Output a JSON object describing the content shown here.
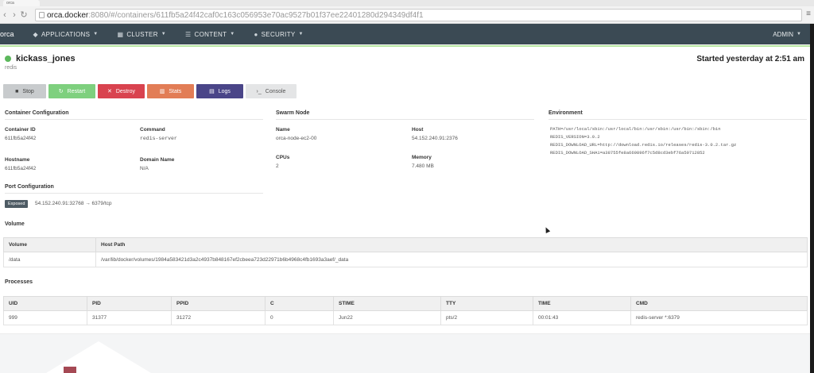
{
  "browser": {
    "tab_title": "orca",
    "url_host": "orca.docker",
    "url_rest": ":8080/#/containers/611fb5a24f42caf0c163c056953e70ac9527b01f37ee22401280d294349df4f1"
  },
  "nav": {
    "brand": "orca",
    "items": [
      {
        "label": "APPLICATIONS",
        "icon": "rocket-icon"
      },
      {
        "label": "CLUSTER",
        "icon": "server-icon"
      },
      {
        "label": "CONTENT",
        "icon": "list-icon"
      },
      {
        "label": "SECURITY",
        "icon": "lock-icon"
      }
    ],
    "admin": "ADMIN"
  },
  "container": {
    "name": "kickass_jones",
    "image": "redis",
    "started": "Started yesterday at 2:51 am",
    "status_color": "#5cb85c"
  },
  "actions": {
    "stop": "Stop",
    "restart": "Restart",
    "destroy": "Destroy",
    "stats": "Stats",
    "logs": "Logs",
    "console": "Console"
  },
  "container_config": {
    "title": "Container Configuration",
    "container_id_label": "Container ID",
    "container_id": "611fb5a24f42",
    "command_label": "Command",
    "command": "redis-server",
    "hostname_label": "Hostname",
    "hostname": "611fb5a24f42",
    "domain_label": "Domain Name",
    "domain": "N/A"
  },
  "swarm_node": {
    "title": "Swarm Node",
    "name_label": "Name",
    "name": "orca-node-ec2-00",
    "host_label": "Host",
    "host": "54.152.240.91:2376",
    "cpus_label": "CPUs",
    "cpus": "2",
    "memory_label": "Memory",
    "memory": "7.480 MB"
  },
  "environment": {
    "title": "Environment",
    "lines": [
      "PATH=/usr/local/sbin:/usr/local/bin:/usr/sbin:/usr/bin:/sbin:/bin",
      "REDIS_VERSION=3.0.2",
      "REDIS_DOWNLOAD_URL=http://download.redis.io/releases/redis-3.0.2.tar.gz",
      "REDIS_DOWNLOAD_SHA1=a38755fe8a669896f7c5d8cd3ebf76a59712852"
    ]
  },
  "port_config": {
    "title": "Port Configuration",
    "badge": "Exposed",
    "mapping": "54.152.240.91:32768 → 6379/tcp"
  },
  "volume": {
    "title": "Volume",
    "headers": [
      "Volume",
      "Host Path"
    ],
    "rows": [
      [
        "/data",
        "/var/lib/docker/volumes/1984a583421d3a2c4937b848167ef2cbeea723d22971b6b4968c4fb1693a3aef/_data"
      ]
    ]
  },
  "processes": {
    "title": "Processes",
    "headers": [
      "UID",
      "PID",
      "PPID",
      "C",
      "STIME",
      "TTY",
      "TIME",
      "CMD"
    ],
    "rows": [
      [
        "999",
        "31377",
        "31272",
        "0",
        "Jun22",
        "pts/2",
        "00:01:43",
        "redis-server *:6379"
      ]
    ]
  }
}
